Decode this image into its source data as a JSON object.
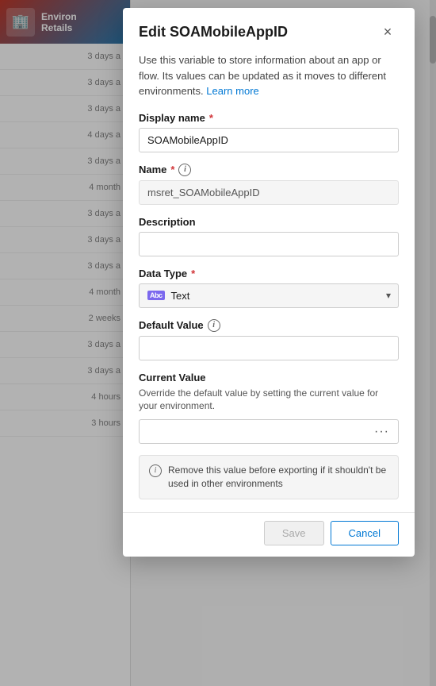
{
  "background": {
    "header": {
      "icon": "🏢",
      "line1": "Environ",
      "line2": "Retails"
    },
    "list_items": [
      {
        "time": "3 days a"
      },
      {
        "time": "3 days a"
      },
      {
        "time": "3 days a"
      },
      {
        "time": "4 days a"
      },
      {
        "time": "3 days a"
      },
      {
        "time": "4 month"
      },
      {
        "time": "3 days a"
      },
      {
        "time": "3 days a"
      },
      {
        "time": "3 days a"
      },
      {
        "time": "4 month"
      },
      {
        "time": "2 weeks"
      },
      {
        "time": "3 days a"
      },
      {
        "time": "3 days a"
      },
      {
        "time": "4 hours"
      },
      {
        "time": "3 hours"
      }
    ]
  },
  "modal": {
    "title": "Edit SOAMobileAppID",
    "close_label": "×",
    "description": "Use this variable to store information about an app or flow. Its values can be updated as it moves to different environments.",
    "learn_more_label": "Learn more",
    "fields": {
      "display_name": {
        "label": "Display name",
        "required": true,
        "value": "SOAMobileAppID",
        "placeholder": ""
      },
      "name": {
        "label": "Name",
        "required": true,
        "value": "msret_SOAMobileAppID",
        "readonly": true
      },
      "description": {
        "label": "Description",
        "required": false,
        "value": "",
        "placeholder": ""
      },
      "data_type": {
        "label": "Data Type",
        "required": true,
        "value": "Text",
        "type_icon_label": "Abc"
      },
      "default_value": {
        "label": "Default Value",
        "has_info": true,
        "value": "",
        "placeholder": ""
      },
      "current_value": {
        "section_label": "Current Value",
        "section_sublabel": "Override the default value by setting the current value for your environment.",
        "value": "",
        "placeholder": "",
        "ellipsis_label": "···"
      }
    },
    "notice": {
      "text": "Remove this value before exporting if it shouldn't be used in other environments"
    },
    "footer": {
      "save_label": "Save",
      "cancel_label": "Cancel"
    }
  }
}
